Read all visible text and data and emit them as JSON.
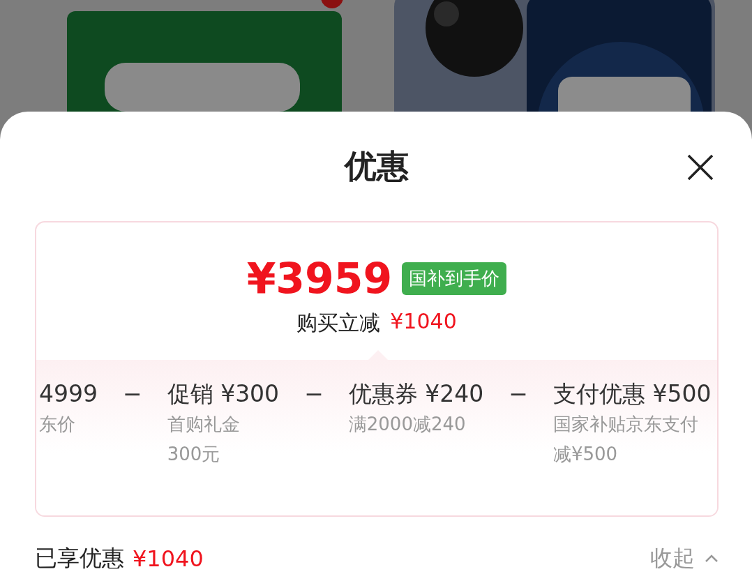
{
  "title": "优惠",
  "summary": {
    "price": "¥3959",
    "badge": "国补到手价",
    "reduction_label": "购买立减",
    "reduction": "¥1040"
  },
  "breakdown": [
    {
      "kind": "item",
      "title": "4999",
      "notes": [
        "东价"
      ]
    },
    {
      "kind": "operator",
      "symbol": "−"
    },
    {
      "kind": "item",
      "title": "促销 ¥300",
      "notes": [
        "首购礼金",
        "300元"
      ]
    },
    {
      "kind": "operator",
      "symbol": "−"
    },
    {
      "kind": "item",
      "title": "优惠券 ¥240",
      "notes": [
        "满2000减240"
      ]
    },
    {
      "kind": "operator",
      "symbol": "−"
    },
    {
      "kind": "item",
      "title": "支付优惠 ¥500",
      "notes": [
        "国家补贴京东支付",
        "减¥500"
      ]
    }
  ],
  "footer": {
    "label": "已享优惠",
    "amount": "¥1040",
    "toggle": "收起"
  }
}
